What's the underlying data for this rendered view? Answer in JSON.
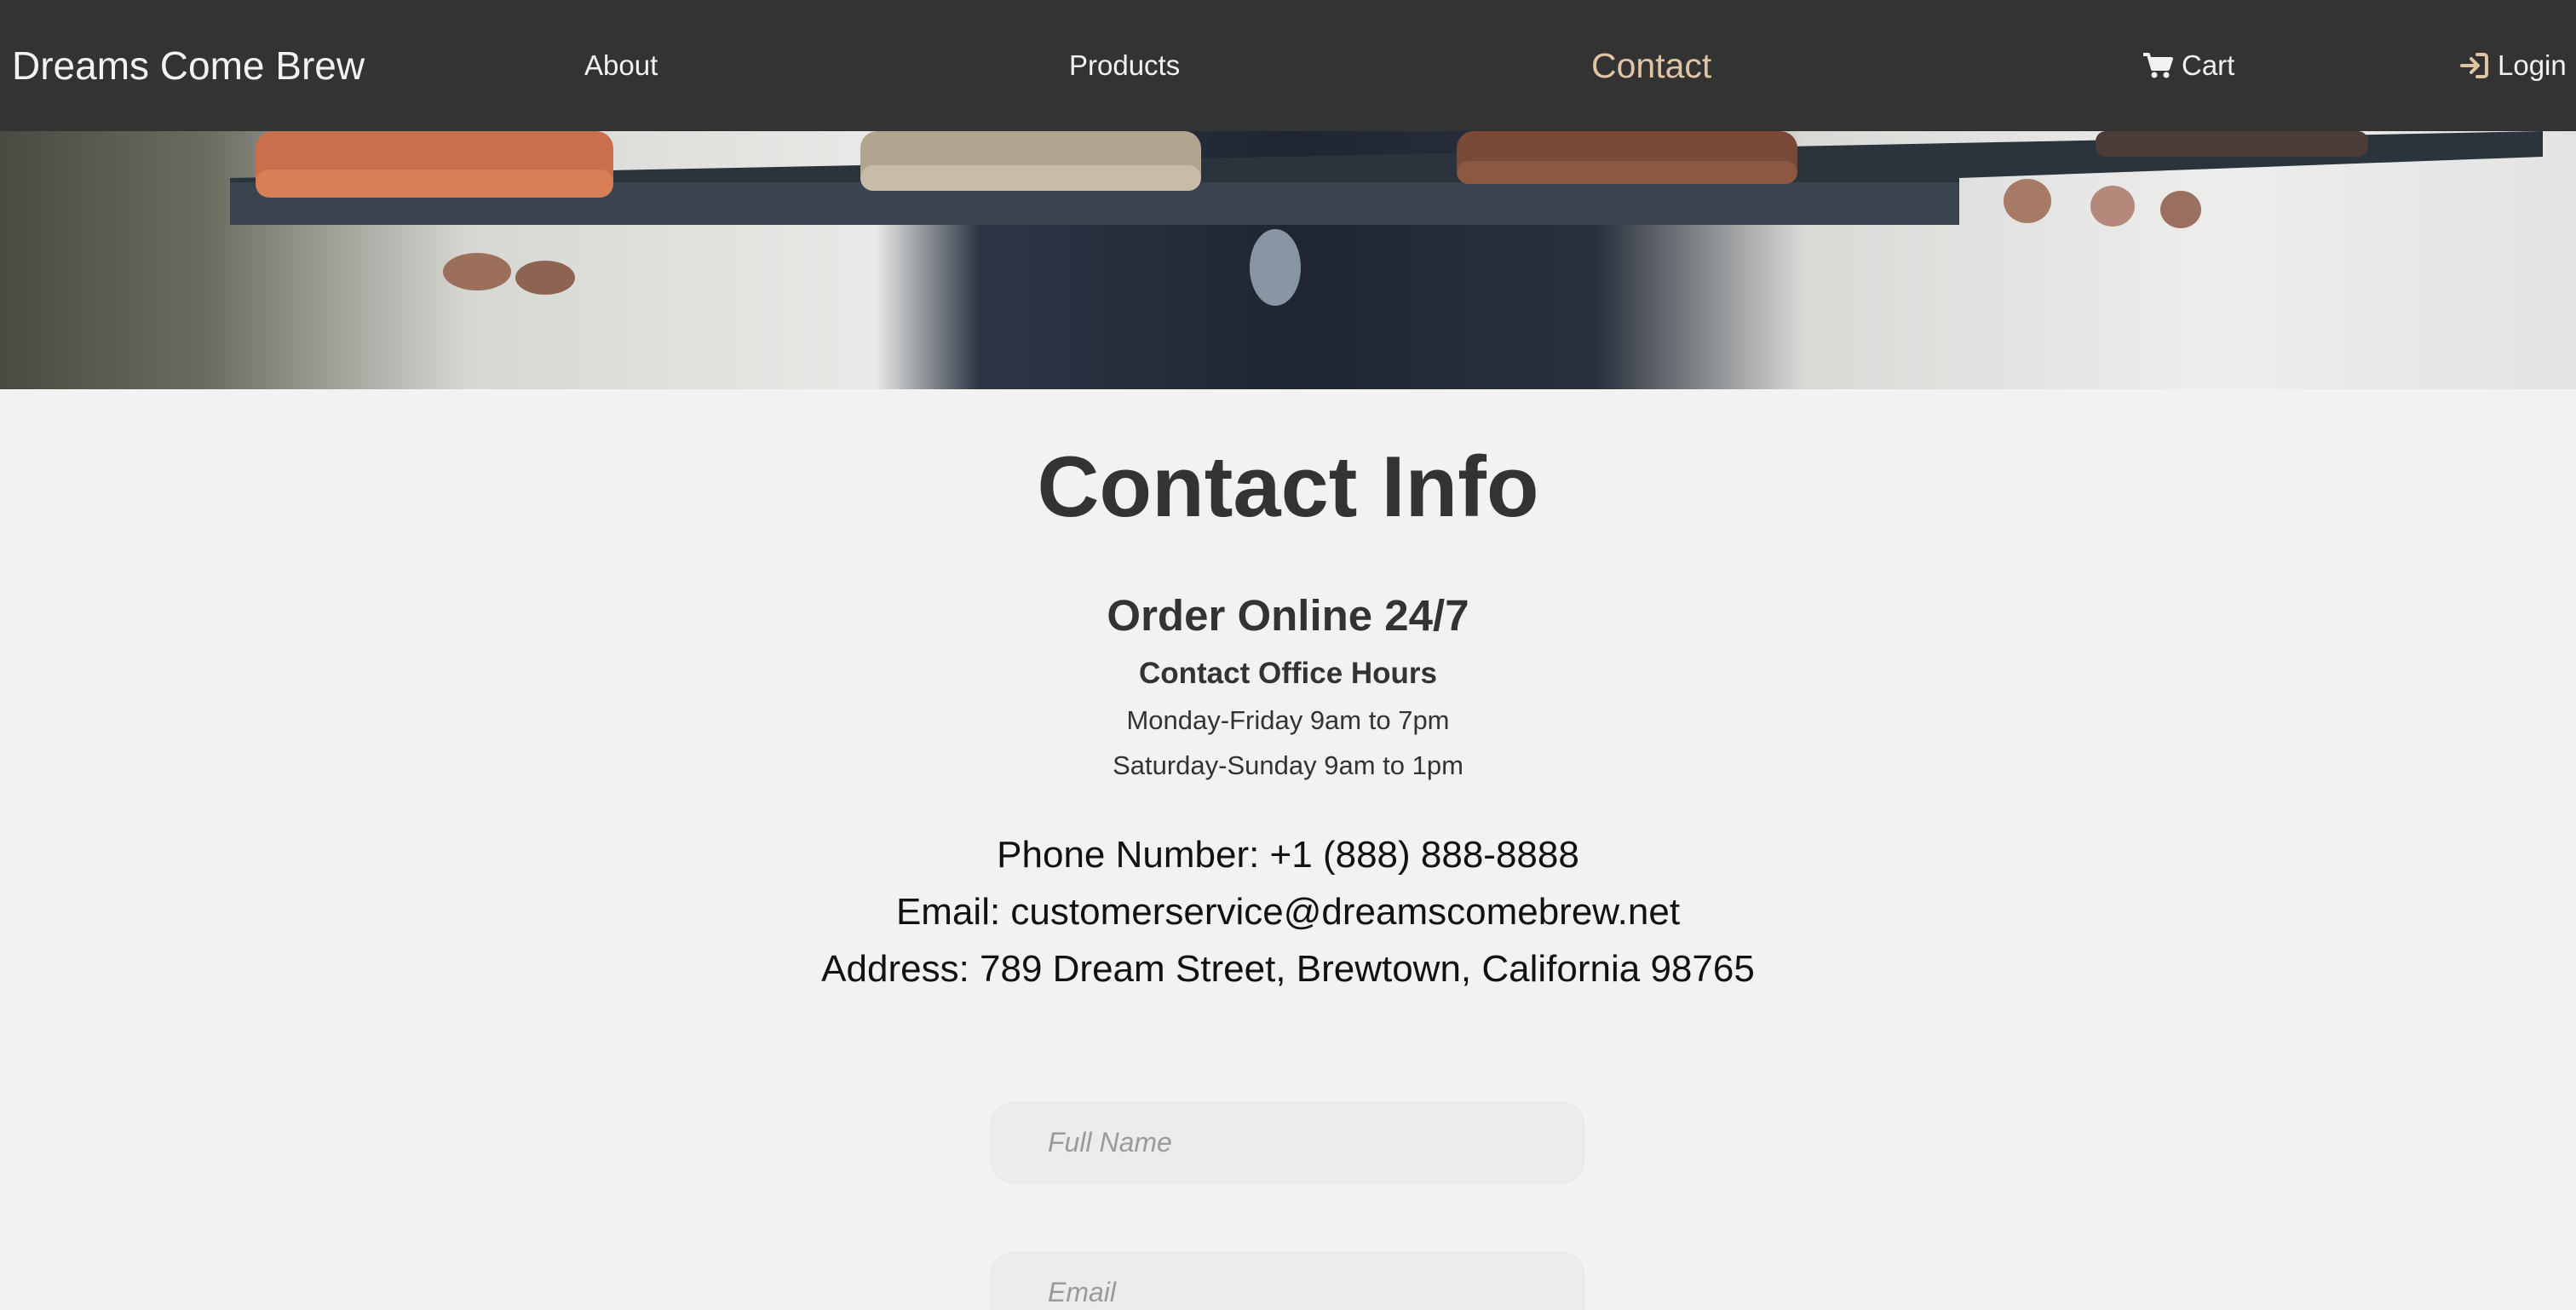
{
  "nav": {
    "brand": "Dreams Come Brew",
    "about": "About",
    "products": "Products",
    "contact": "Contact",
    "cart": "Cart",
    "login": "Login",
    "cart_icon": "cart-icon",
    "login_icon": "sign-in-icon"
  },
  "hero": {
    "image": "coffee-cups-tray-photo"
  },
  "content": {
    "title": "Contact Info",
    "subtitle": "Order Online 24/7",
    "hours_heading": "Contact Office Hours",
    "hours_weekday": "Monday-Friday 9am to 7pm",
    "hours_weekend": "Saturday-Sunday 9am to 1pm",
    "phone": "Phone Number: +1 (888) 888-8888",
    "email": "Email: customerservice@dreamscomebrew.net",
    "address": "Address: 789 Dream Street, Brewtown, California 98765"
  },
  "form": {
    "name_placeholder": "Full Name",
    "email_placeholder": "Email"
  },
  "colors": {
    "nav_bg": "#333333",
    "nav_text": "#f2f2f2",
    "accent": "#e0c5a2",
    "page_bg": "#f2f2f2"
  }
}
